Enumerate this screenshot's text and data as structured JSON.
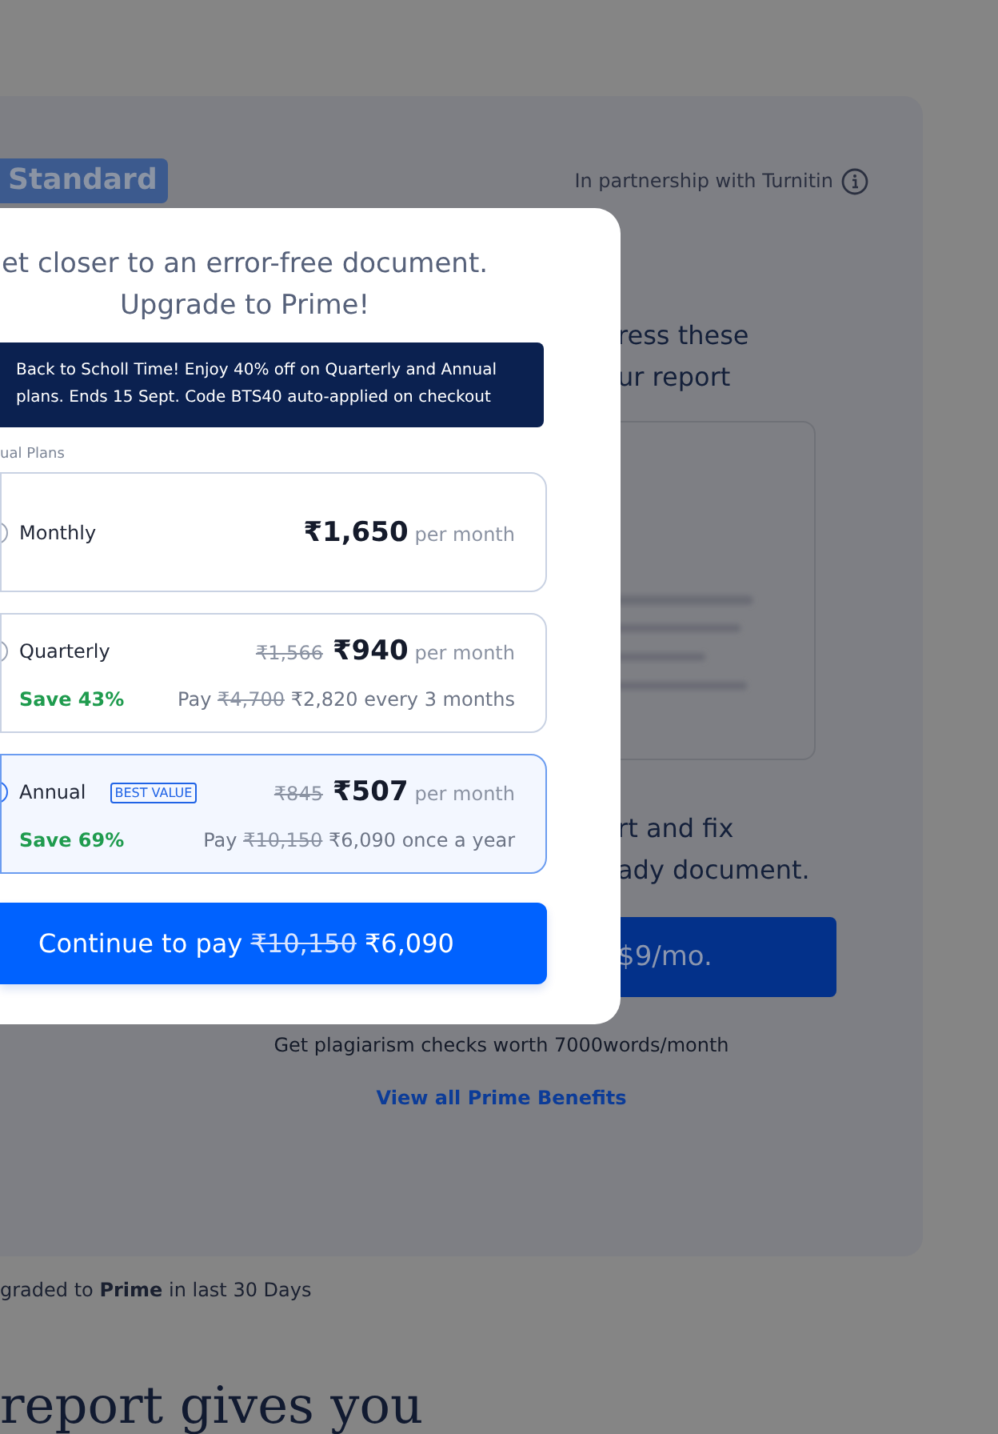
{
  "page": {
    "badge": "Standard",
    "partnership": "In partnership with Turnitin",
    "heading_lines": [
      "ress these",
      "ur report"
    ],
    "fix_lines": [
      "rt and fix",
      "ady document."
    ],
    "price_button": "$9/mo.",
    "checks_note": "Get plagiarism checks worth 7000words/month",
    "benefits_link": "View all Prime Benefits",
    "upgraded_note": "graded to **Prime** in last 30 Days",
    "section_heading": "report gives you"
  },
  "modal": {
    "title_lines": [
      "et closer to an error-free document.",
      "Upgrade to Prime!"
    ],
    "banner": "Back to Scholl Time! Enjoy 40% off on Quarterly and Annual plans. Ends 15 Sept. Code BTS40 auto-applied on checkout",
    "plans_label": "ual Plans",
    "plans": [
      {
        "name": "Monthly",
        "selected": false,
        "price": "₹1,650",
        "unit": "per month"
      },
      {
        "name": "Quarterly",
        "selected": false,
        "old_price": "₹1,566",
        "price": "₹940",
        "unit": "per month",
        "save": "Save 43%",
        "pay_label": "Pay",
        "old_total": "₹4,700",
        "total": "₹2,820 every 3 months"
      },
      {
        "name": "Annual",
        "selected": true,
        "badge": "BEST VALUE",
        "old_price": "₹845",
        "price": "₹507",
        "unit": "per month",
        "save": "Save 69%",
        "pay_label": "Pay",
        "old_total": "₹10,150",
        "total": "₹6,090 once a year"
      }
    ],
    "button": {
      "label": "Continue to pay",
      "old_price": "₹10,150",
      "price": "₹6,090"
    }
  }
}
